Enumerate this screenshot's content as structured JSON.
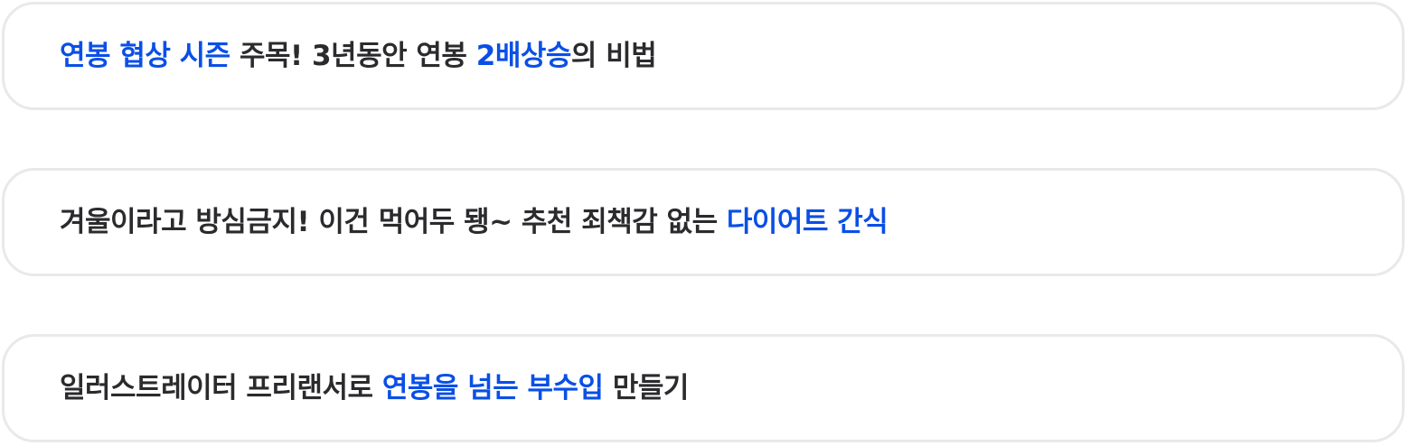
{
  "colors": {
    "highlight": "#0a4fe6",
    "text": "#2b2b2e",
    "border": "#e9e9ec",
    "background": "#ffffff"
  },
  "cards": [
    {
      "segments": [
        {
          "text": "연봉 협상 시즌",
          "highlight": true
        },
        {
          "text": " 주목! 3년동안 연봉 ",
          "highlight": false
        },
        {
          "text": "2배상승",
          "highlight": true
        },
        {
          "text": "의 비법",
          "highlight": false
        }
      ]
    },
    {
      "segments": [
        {
          "text": "겨울이라고 방심금지! 이건 먹어두 됑~ 추천 죄책감 없는 ",
          "highlight": false
        },
        {
          "text": "다이어트 간식",
          "highlight": true
        }
      ]
    },
    {
      "segments": [
        {
          "text": "일러스트레이터 프리랜서로 ",
          "highlight": false
        },
        {
          "text": "연봉을 넘는 부수입",
          "highlight": true
        },
        {
          "text": " 만들기",
          "highlight": false
        }
      ]
    }
  ]
}
